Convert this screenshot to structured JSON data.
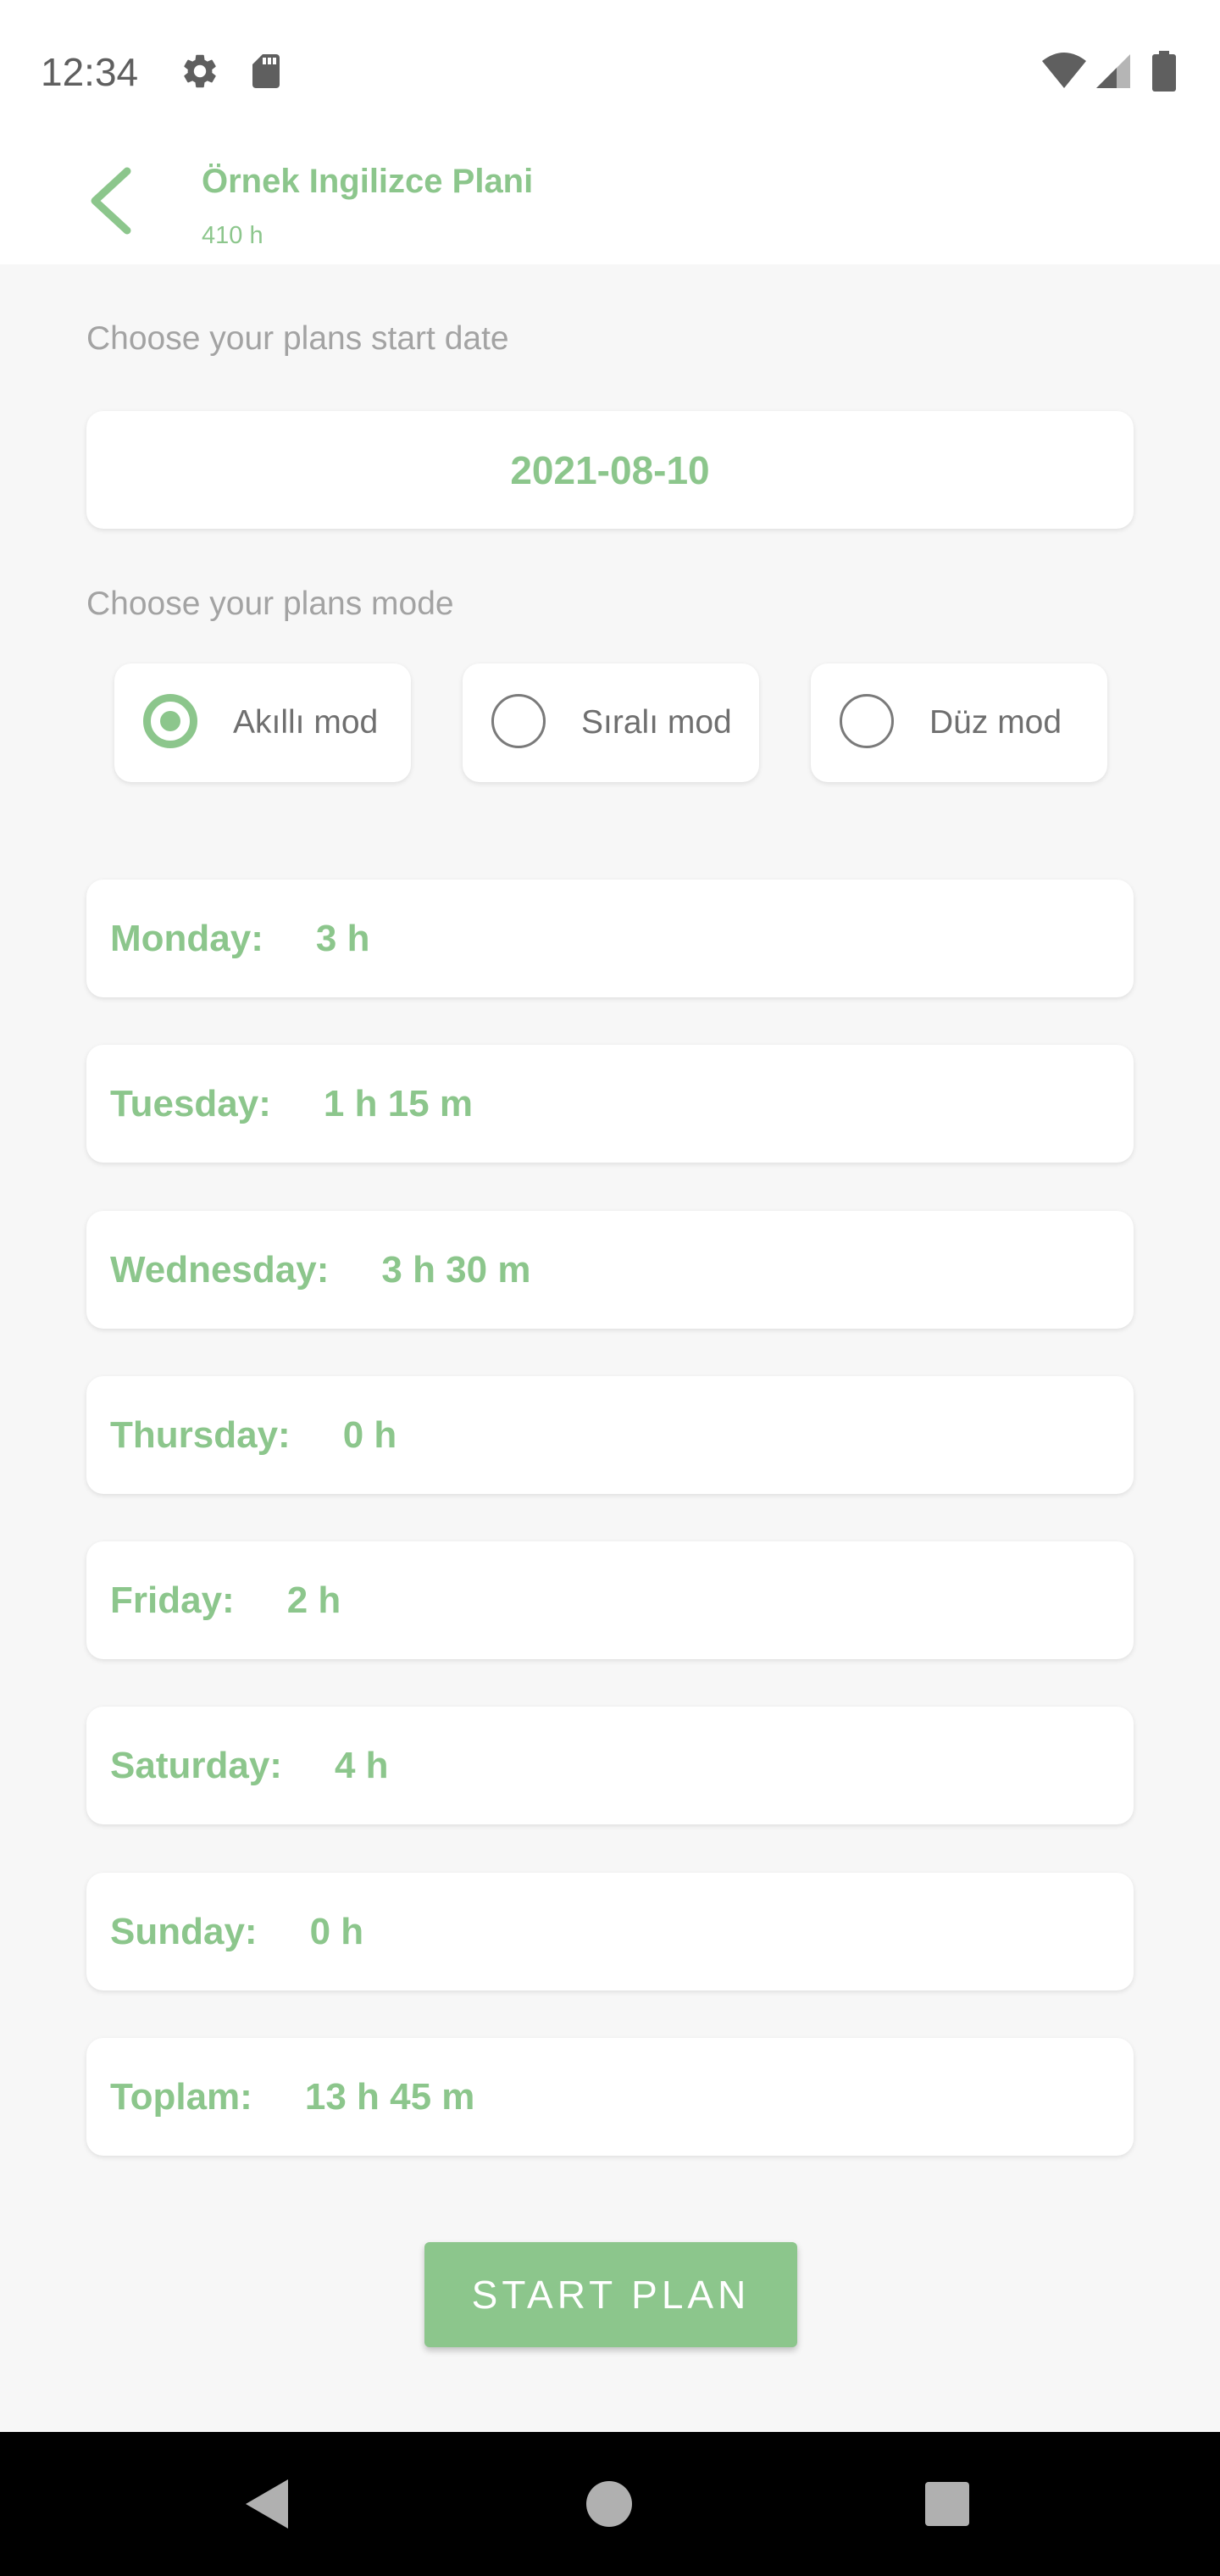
{
  "status_bar": {
    "time": "12:34",
    "left_icons": [
      "gear-icon",
      "sd-card-icon"
    ],
    "right_icons": [
      "wifi-icon",
      "signal-icon",
      "battery-icon"
    ]
  },
  "app_bar": {
    "title": "Örnek Ingilizce Plani",
    "subtitle": "410 h"
  },
  "start_date": {
    "label": "Choose your plans start date",
    "value": "2021-08-10"
  },
  "mode": {
    "label": "Choose your plans mode",
    "options": [
      {
        "label": "Akıllı mod",
        "selected": true
      },
      {
        "label": "Sıralı mod",
        "selected": false
      },
      {
        "label": "Düz mod",
        "selected": false
      }
    ]
  },
  "schedule": [
    {
      "day": "Monday:",
      "value": "3 h"
    },
    {
      "day": "Tuesday:",
      "value": "1 h 15 m"
    },
    {
      "day": "Wednesday:",
      "value": "3 h 30 m"
    },
    {
      "day": "Thursday:",
      "value": "0 h"
    },
    {
      "day": "Friday:",
      "value": "2 h"
    },
    {
      "day": "Saturday:",
      "value": "4 h"
    },
    {
      "day": "Sunday:",
      "value": "0 h"
    },
    {
      "day": "Toplam:",
      "value": "13 h 45 m"
    }
  ],
  "start_button_label": "START PLAN",
  "colors": {
    "accent": "#8cc68c",
    "background": "#f7f7f7",
    "card": "#ffffff"
  }
}
